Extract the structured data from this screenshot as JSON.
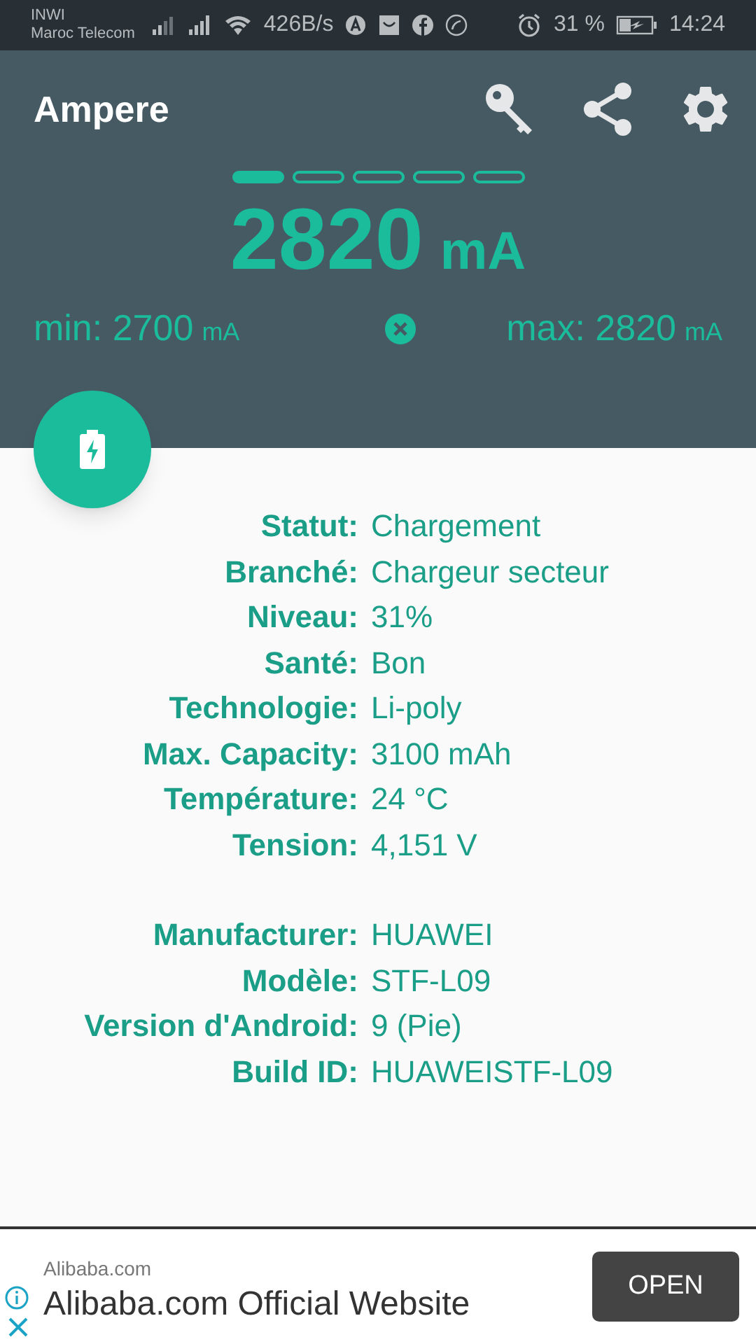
{
  "status_bar": {
    "carrier_1": "INWI",
    "carrier_2": "Maroc Telecom",
    "speed": "426B/s",
    "battery": "31 %",
    "time": "14:24"
  },
  "app_bar": {
    "title": "Ampere"
  },
  "pages": [
    {
      "selected": true
    },
    {
      "selected": false
    },
    {
      "selected": false
    },
    {
      "selected": false
    },
    {
      "selected": false
    }
  ],
  "current": {
    "value": "2820",
    "unit": "mA"
  },
  "min": {
    "label": "min: 2700",
    "unit": "mA"
  },
  "max": {
    "label": "max: 2820",
    "unit": "mA"
  },
  "info_groups": [
    {
      "rows": [
        {
          "label": "Statut:",
          "value": "Chargement"
        },
        {
          "label": "Branché:",
          "value": "Chargeur secteur"
        },
        {
          "label": "Niveau:",
          "value": "31%"
        },
        {
          "label": "Santé:",
          "value": "Bon"
        },
        {
          "label": "Technologie:",
          "value": "Li-poly"
        },
        {
          "label": "Max. Capacity:",
          "value": "3100 mAh"
        },
        {
          "label": "Température:",
          "value": "24 °C"
        },
        {
          "label": "Tension:",
          "value": "4,151 V"
        }
      ]
    },
    {
      "rows": [
        {
          "label": "Manufacturer:",
          "value": "HUAWEI"
        },
        {
          "label": "Modèle:",
          "value": "STF-L09"
        },
        {
          "label": "Version d'Android:",
          "value": "9 (Pie)"
        },
        {
          "label": "Build ID:",
          "value": "HUAWEISTF-L09"
        }
      ]
    }
  ],
  "ad": {
    "advertiser": "Alibaba.com",
    "headline": "Alibaba.com Official Website",
    "button": "OPEN"
  }
}
